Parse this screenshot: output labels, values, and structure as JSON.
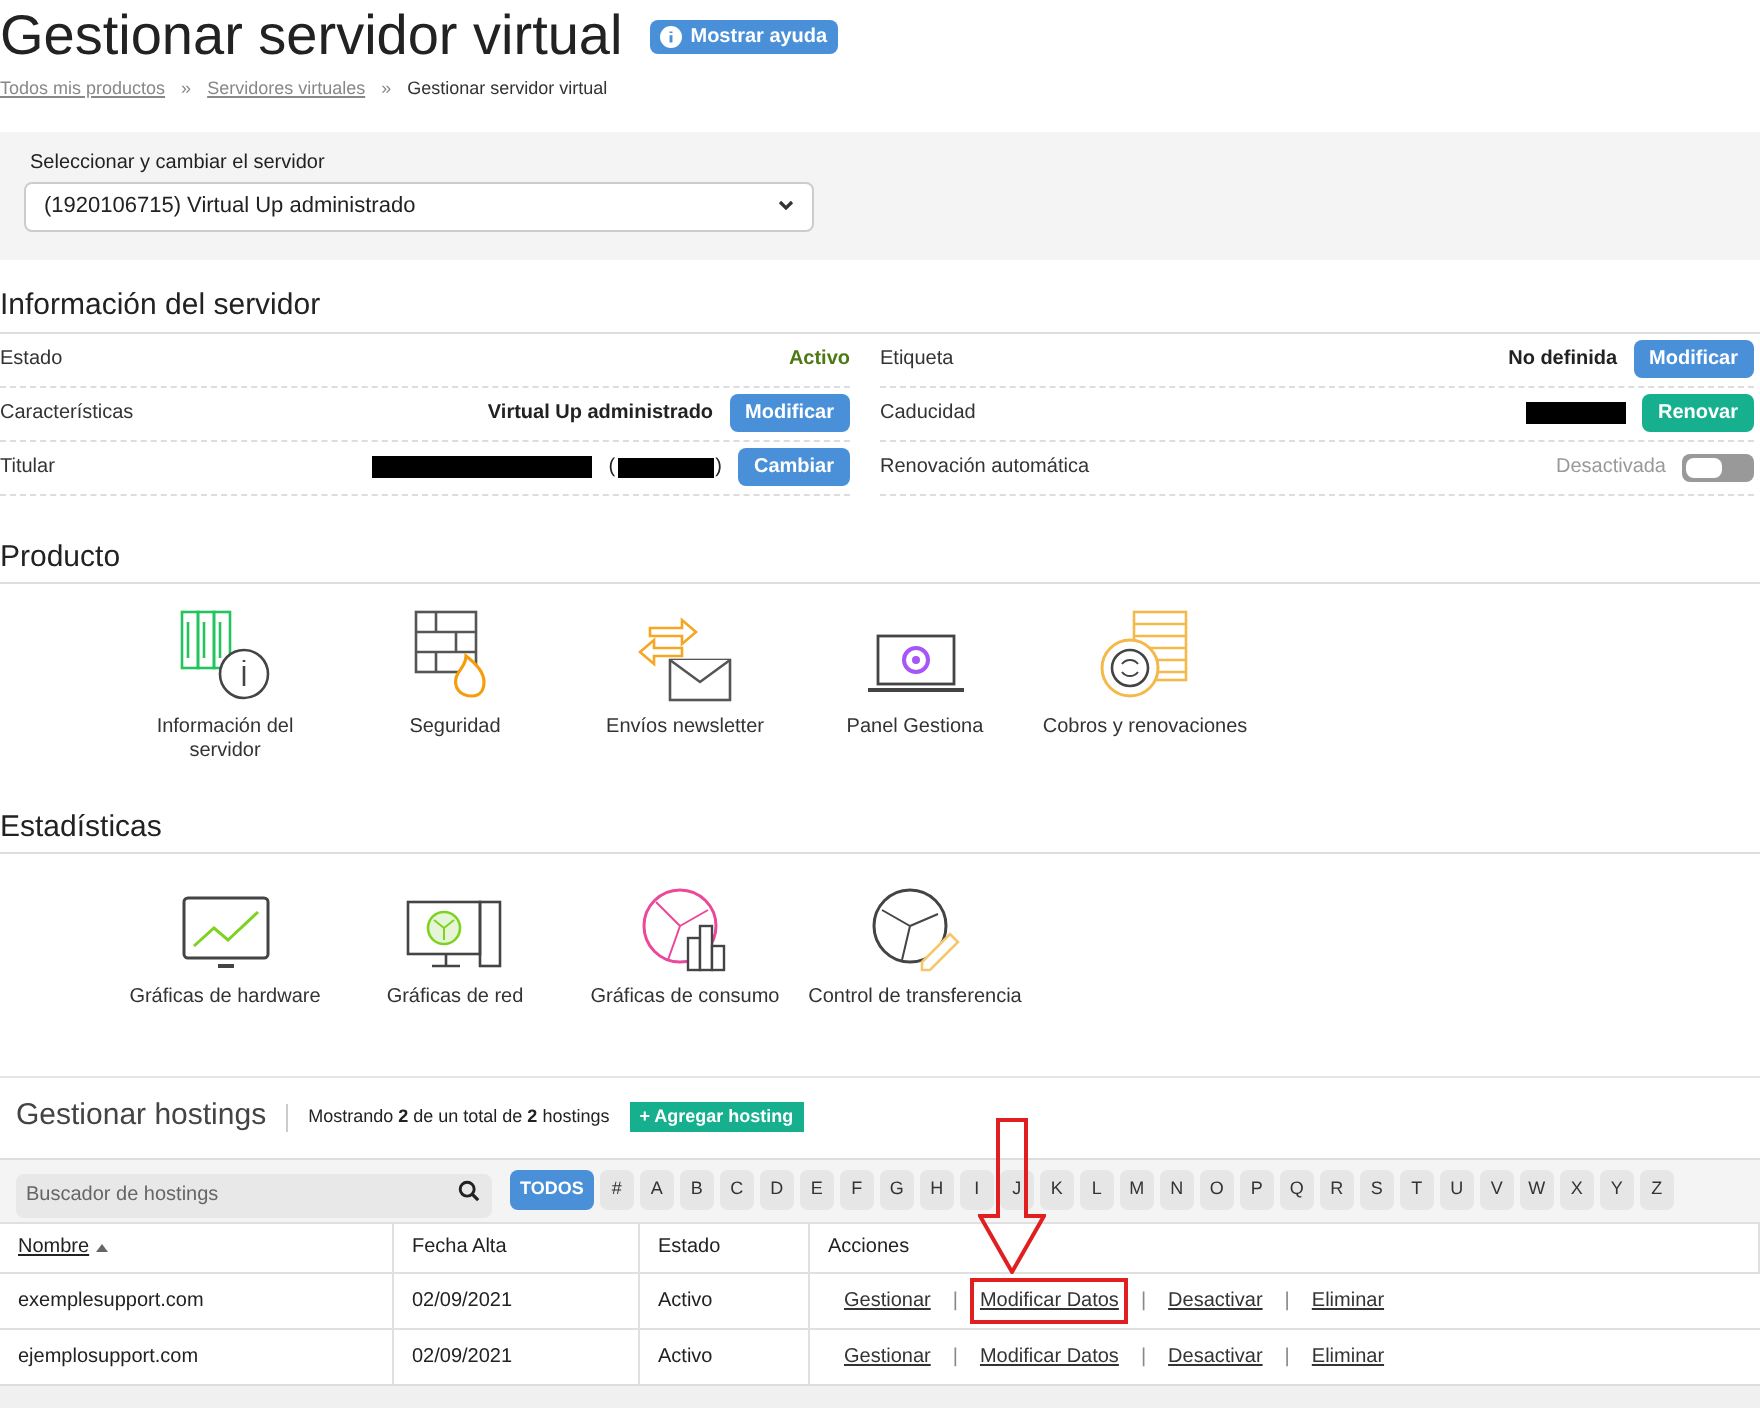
{
  "title": "Gestionar servidor virtual",
  "help_button": "Mostrar ayuda",
  "breadcrumb": [
    {
      "label": "Todos mis productos",
      "link": true
    },
    {
      "label": "Servidores virtuales",
      "link": true
    },
    {
      "label": "Gestionar servidor virtual",
      "link": false
    }
  ],
  "breadcrumb_separator": "»",
  "server_select": {
    "label": "Seleccionar y cambiar el servidor",
    "value": "(1920106715) Virtual Up administrado"
  },
  "server_info": {
    "title": "Información del servidor",
    "left": [
      {
        "kind": "status",
        "label": "Estado",
        "value": "Activo"
      },
      {
        "kind": "button",
        "label": "Características",
        "value": "Virtual Up administrado",
        "button": "Modificar"
      },
      {
        "kind": "redacted",
        "label": "Titular",
        "open": "(",
        "close": ")",
        "button": "Cambiar"
      }
    ],
    "right": [
      {
        "kind": "button",
        "label": "Etiqueta",
        "value": "No definida",
        "button": "Modificar"
      },
      {
        "kind": "renew",
        "label": "Caducidad",
        "button": "Renovar"
      },
      {
        "kind": "toggle",
        "label": "Renovación automática",
        "value": "Desactivada",
        "on": false
      }
    ]
  },
  "product": {
    "title": "Producto",
    "items": [
      "Información del servidor",
      "Seguridad",
      "Envíos newsletter",
      "Panel Gestiona",
      "Cobros y renovaciones"
    ]
  },
  "stats": {
    "title": "Estadísticas",
    "items": [
      "Gráficas de hardware",
      "Gráficas de red",
      "Gráficas de consumo",
      "Control de transferencia"
    ]
  },
  "hostings": {
    "title": "Gestionar hostings",
    "summary": "Mostrando **2** de un total de **2** hostings",
    "add_button": "+ Agregar hosting",
    "search_placeholder": "Buscador de hostings",
    "letters": [
      {
        "label": "TODOS",
        "selected": true
      },
      {
        "label": "#",
        "selected": false
      },
      {
        "label": "A",
        "selected": false
      },
      {
        "label": "B",
        "selected": false
      },
      {
        "label": "C",
        "selected": false
      },
      {
        "label": "D",
        "selected": false
      },
      {
        "label": "E",
        "selected": false
      },
      {
        "label": "F",
        "selected": false
      },
      {
        "label": "G",
        "selected": false
      },
      {
        "label": "H",
        "selected": false
      },
      {
        "label": "I",
        "selected": false
      },
      {
        "label": "J",
        "selected": false
      },
      {
        "label": "K",
        "selected": false
      },
      {
        "label": "L",
        "selected": false
      },
      {
        "label": "M",
        "selected": false
      },
      {
        "label": "N",
        "selected": false
      },
      {
        "label": "O",
        "selected": false
      },
      {
        "label": "P",
        "selected": false
      },
      {
        "label": "Q",
        "selected": false
      },
      {
        "label": "R",
        "selected": false
      },
      {
        "label": "S",
        "selected": false
      },
      {
        "label": "T",
        "selected": false
      },
      {
        "label": "U",
        "selected": false
      },
      {
        "label": "V",
        "selected": false
      },
      {
        "label": "W",
        "selected": false
      },
      {
        "label": "X",
        "selected": false
      },
      {
        "label": "Y",
        "selected": false
      },
      {
        "label": "Z",
        "selected": false
      }
    ],
    "columns": [
      {
        "label": "Nombre",
        "sortable": true
      },
      {
        "label": "Fecha Alta",
        "sortable": false
      },
      {
        "label": "Estado",
        "sortable": false
      },
      {
        "label": "Acciones",
        "sortable": false
      }
    ],
    "separator": "|",
    "rows": [
      {
        "name": "exemplesupport.com",
        "date": "02/09/2021",
        "status": "Activo",
        "actions": [
          {
            "label": "Gestionar",
            "highlighted": false
          },
          {
            "label": "Modificar Datos",
            "highlighted": true
          },
          {
            "label": "Desactivar",
            "highlighted": false
          },
          {
            "label": "Eliminar",
            "highlighted": false
          }
        ]
      },
      {
        "name": "ejemplosupport.com",
        "date": "02/09/2021",
        "status": "Activo",
        "actions": [
          {
            "label": "Gestionar",
            "highlighted": false
          },
          {
            "label": "Modificar Datos",
            "highlighted": false
          },
          {
            "label": "Desactivar",
            "highlighted": false
          },
          {
            "label": "Eliminar",
            "highlighted": false
          }
        ]
      }
    ]
  }
}
